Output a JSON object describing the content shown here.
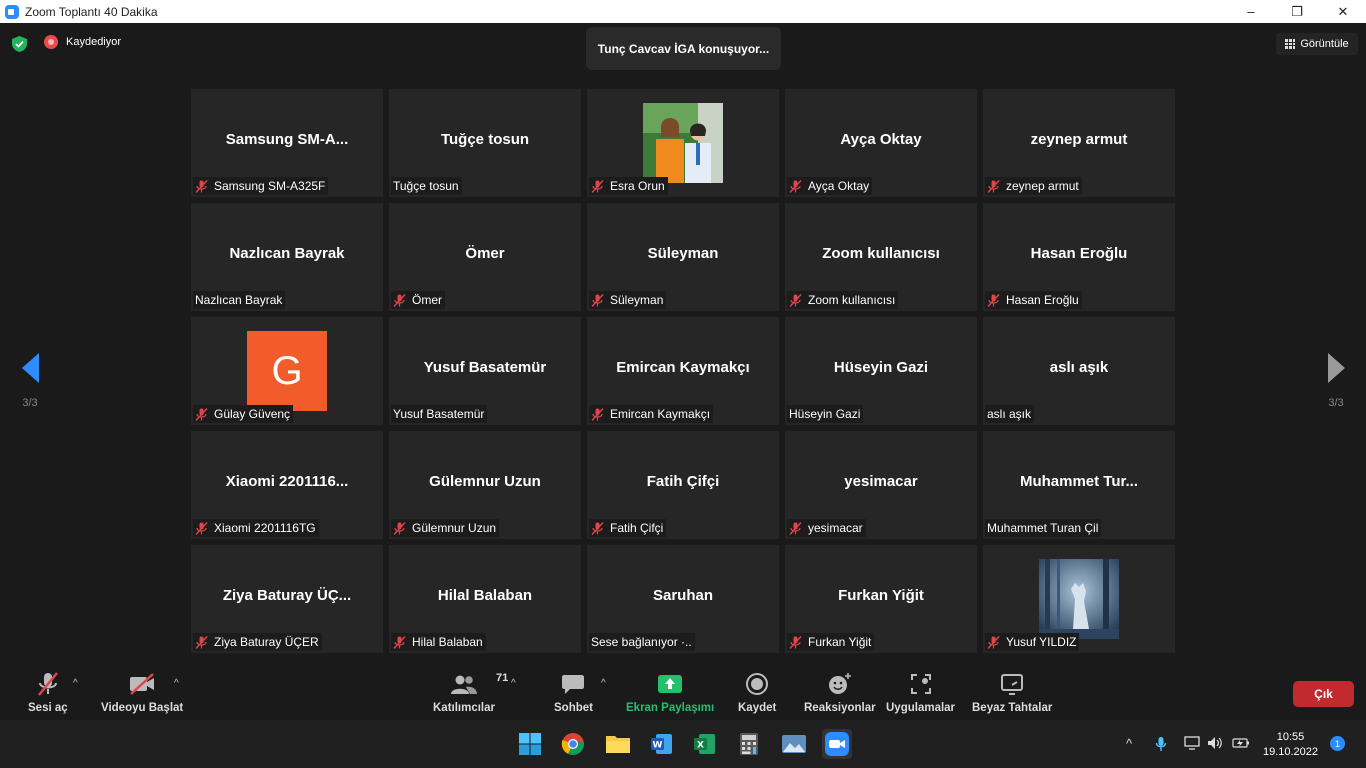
{
  "window": {
    "title": "Zoom Toplantı 40 Dakika",
    "minimize": "–",
    "maximize": "❐",
    "close": "✕"
  },
  "header": {
    "recording": "Kaydediyor",
    "speaker": "Tunç Cavcav İGA konuşuyor...",
    "view_button": "Görüntüle"
  },
  "pager": {
    "left": "3/3",
    "right": "3/3"
  },
  "participants": [
    {
      "display": "Samsung  SM-A...",
      "label": "Samsung SM-A325F",
      "muted": true
    },
    {
      "display": "Tuğçe tosun",
      "label": "Tuğçe tosun",
      "muted": false
    },
    {
      "display": "",
      "label": "Esra Orun",
      "muted": true,
      "media": "photo-two-people"
    },
    {
      "display": "Ayça Oktay",
      "label": "Ayça Oktay",
      "muted": true
    },
    {
      "display": "zeynep armut",
      "label": "zeynep armut",
      "muted": true
    },
    {
      "display": "Nazlıcan Bayrak",
      "label": "Nazlıcan Bayrak",
      "muted": false
    },
    {
      "display": "Ömer",
      "label": "Ömer",
      "muted": true
    },
    {
      "display": "Süleyman",
      "label": "Süleyman",
      "muted": true
    },
    {
      "display": "Zoom kullanıcısı",
      "label": "Zoom kullanıcısı",
      "muted": true
    },
    {
      "display": "Hasan Eroğlu",
      "label": "Hasan Eroğlu",
      "muted": true
    },
    {
      "display": "",
      "label": "Gülay Güvenç",
      "muted": true,
      "media": "avatar-letter",
      "avatar_letter": "G"
    },
    {
      "display": "Yusuf Basatemür",
      "label": "Yusuf Basatemür",
      "muted": false
    },
    {
      "display": "Emircan Kaymakçı",
      "label": "Emircan Kaymakçı",
      "muted": true
    },
    {
      "display": "Hüseyin Gazi",
      "label": "Hüseyin Gazi",
      "muted": false
    },
    {
      "display": "aslı aşık",
      "label": "aslı aşık",
      "muted": false
    },
    {
      "display": "Xiaomi 2201116...",
      "label": "Xiaomi 2201116TG",
      "muted": true
    },
    {
      "display": "Gülemnur Uzun",
      "label": "Gülemnur Uzun",
      "muted": true
    },
    {
      "display": "Fatih Çifçi",
      "label": "Fatih Çifçi",
      "muted": true
    },
    {
      "display": "yesimacar",
      "label": "yesimacar",
      "muted": true
    },
    {
      "display": "Muhammet  Tur...",
      "label": "Muhammet Turan Çil",
      "muted": false
    },
    {
      "display": "Ziya  Baturay  ÜÇ...",
      "label": "Ziya Baturay ÜÇER",
      "muted": true
    },
    {
      "display": "Hilal Balaban",
      "label": "Hilal Balaban",
      "muted": true
    },
    {
      "display": "Saruhan",
      "label": "Sese bağlanıyor ·..",
      "muted": false
    },
    {
      "display": "Furkan Yiğit",
      "label": "Furkan Yiğit",
      "muted": true
    },
    {
      "display": "",
      "label": "Yusuf YILDIZ",
      "muted": true,
      "media": "photo-wolf"
    }
  ],
  "toolbar": {
    "unmute": "Sesi aç",
    "start_video": "Videoyu Başlat",
    "participants": "Katılımcılar",
    "participants_count": "71",
    "chat": "Sohbet",
    "share_screen": "Ekran Paylaşımı",
    "record": "Kaydet",
    "reactions": "Reaksiyonlar",
    "apps": "Uygulamalar",
    "whiteboard": "Beyaz Tahtalar",
    "leave": "Çık",
    "caret": "^"
  },
  "taskbar": {
    "time": "10:55",
    "date": "19.10.2022",
    "notifications": "1",
    "tray_caret": "^",
    "apps": [
      "windows-start",
      "chrome",
      "file-explorer",
      "word",
      "excel",
      "calculator",
      "photos",
      "zoom"
    ]
  },
  "colors": {
    "accent": "#2d8cff",
    "share_green": "#23c16b",
    "leave_red": "#c12a2f",
    "mute_red": "#e0454a",
    "avatar_orange": "#f25b2a"
  }
}
